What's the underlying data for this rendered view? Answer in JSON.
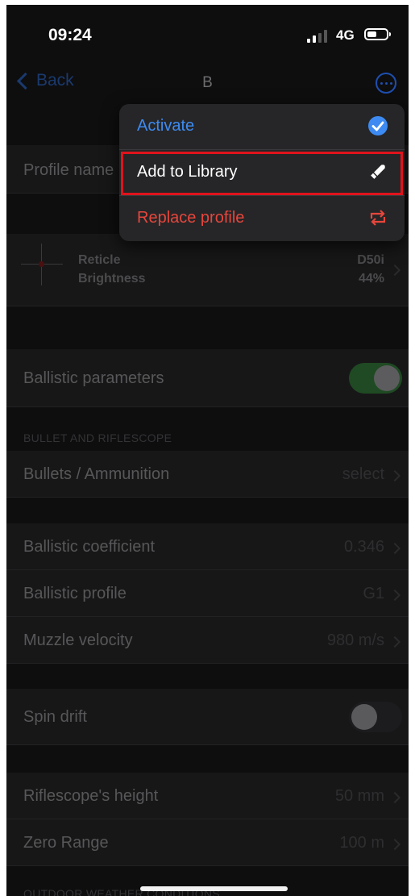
{
  "status_bar": {
    "time": "09:24",
    "network": "4G"
  },
  "nav": {
    "back_label": "Back",
    "title": "B"
  },
  "profile": {
    "name_label": "Profile name"
  },
  "reticle": {
    "label_1": "Reticle",
    "label_2": "Brightness",
    "value_1": "D50i",
    "value_2": "44%"
  },
  "ballistic_parameters": {
    "label": "Ballistic parameters",
    "enabled": true
  },
  "section_bullet": {
    "header": "BULLET AND RIFLESCOPE"
  },
  "bullets": {
    "label": "Bullets / Ammunition",
    "value": "select"
  },
  "coefficient": {
    "label": "Ballistic coefficient",
    "value": "0.346"
  },
  "profile_type": {
    "label": "Ballistic profile",
    "value": "G1"
  },
  "muzzle": {
    "label": "Muzzle velocity",
    "value": "980 m/s"
  },
  "spin_drift": {
    "label": "Spin drift",
    "enabled": false
  },
  "scope_height": {
    "label": "Riflescope's height",
    "value": "50 mm"
  },
  "zero_range": {
    "label": "Zero Range",
    "value": "100 m"
  },
  "section_weather": {
    "header": "OUTDOOR WEATHER CONDITIONS"
  },
  "menu": {
    "items": [
      {
        "label": "Activate",
        "icon": "checkmark-circle-icon",
        "color": "#3d8bf2"
      },
      {
        "label": "Add to Library",
        "icon": "bullet-icon",
        "color": "#ffffff"
      },
      {
        "label": "Replace profile",
        "icon": "swap-arrows-icon",
        "color": "#e6463c"
      }
    ],
    "highlight_color": "#e0131c"
  }
}
